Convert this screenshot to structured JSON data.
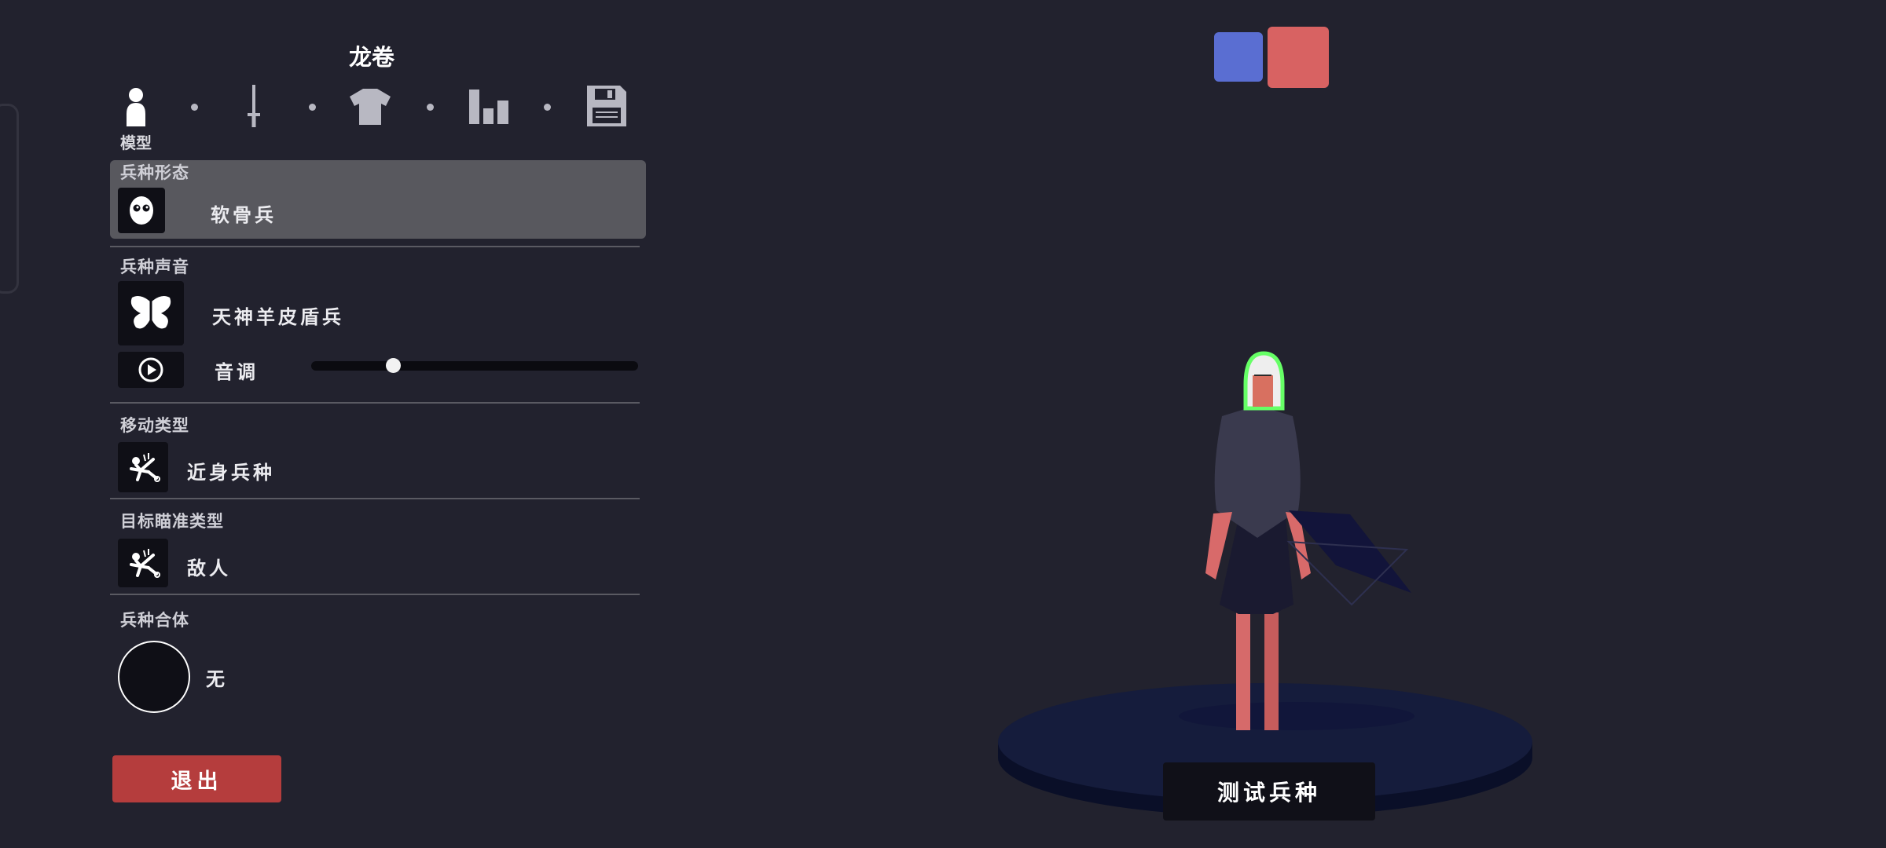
{
  "header": {
    "title": "龙卷"
  },
  "tabs": [
    {
      "icon": "person-icon",
      "label": "模型",
      "active": true
    },
    {
      "icon": "sword-icon"
    },
    {
      "icon": "shirt-icon"
    },
    {
      "icon": "bar-chart-icon"
    },
    {
      "icon": "floppy-disk-icon"
    }
  ],
  "sections": {
    "form": {
      "label": "兵种形态",
      "value": "软骨兵",
      "icon": "ragdoll-face-icon"
    },
    "voice": {
      "label": "兵种声音",
      "value": "天神羊皮盾兵",
      "icon": "butterfly-icon",
      "pitch_label": "音调",
      "pitch_level": 0.25,
      "play_icon": "play-icon"
    },
    "movement": {
      "label": "移动类型",
      "value": "近身兵种",
      "icon": "stickman-fall-icon"
    },
    "target": {
      "label": "目标瞄准类型",
      "value": "敌人",
      "icon": "stickman-fall-icon"
    },
    "combo": {
      "label": "兵种合体",
      "value": "无"
    }
  },
  "buttons": {
    "exit": "退出",
    "test": "测试兵种"
  },
  "team_colors": {
    "blue": "#5a6ed2",
    "red": "#d86262"
  },
  "colors": {
    "background": "#22222e",
    "exit_button": "#b53d3d",
    "highlight": "#58585e"
  }
}
